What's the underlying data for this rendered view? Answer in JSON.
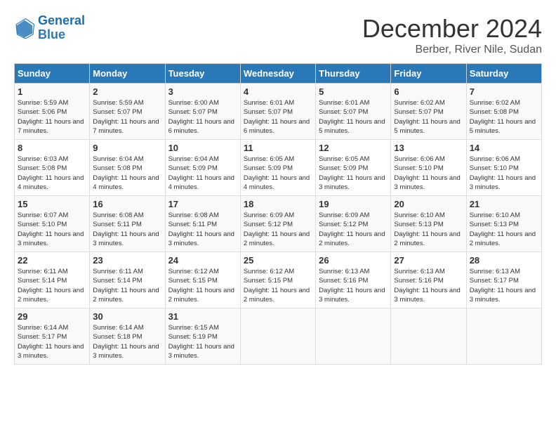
{
  "header": {
    "logo_general": "General",
    "logo_blue": "Blue",
    "month_title": "December 2024",
    "location": "Berber, River Nile, Sudan"
  },
  "days_of_week": [
    "Sunday",
    "Monday",
    "Tuesday",
    "Wednesday",
    "Thursday",
    "Friday",
    "Saturday"
  ],
  "weeks": [
    [
      {
        "day": "1",
        "sunrise": "5:59 AM",
        "sunset": "5:06 PM",
        "daylight": "11 hours and 7 minutes."
      },
      {
        "day": "2",
        "sunrise": "5:59 AM",
        "sunset": "5:07 PM",
        "daylight": "11 hours and 7 minutes."
      },
      {
        "day": "3",
        "sunrise": "6:00 AM",
        "sunset": "5:07 PM",
        "daylight": "11 hours and 6 minutes."
      },
      {
        "day": "4",
        "sunrise": "6:01 AM",
        "sunset": "5:07 PM",
        "daylight": "11 hours and 6 minutes."
      },
      {
        "day": "5",
        "sunrise": "6:01 AM",
        "sunset": "5:07 PM",
        "daylight": "11 hours and 5 minutes."
      },
      {
        "day": "6",
        "sunrise": "6:02 AM",
        "sunset": "5:07 PM",
        "daylight": "11 hours and 5 minutes."
      },
      {
        "day": "7",
        "sunrise": "6:02 AM",
        "sunset": "5:08 PM",
        "daylight": "11 hours and 5 minutes."
      }
    ],
    [
      {
        "day": "8",
        "sunrise": "6:03 AM",
        "sunset": "5:08 PM",
        "daylight": "11 hours and 4 minutes."
      },
      {
        "day": "9",
        "sunrise": "6:04 AM",
        "sunset": "5:08 PM",
        "daylight": "11 hours and 4 minutes."
      },
      {
        "day": "10",
        "sunrise": "6:04 AM",
        "sunset": "5:09 PM",
        "daylight": "11 hours and 4 minutes."
      },
      {
        "day": "11",
        "sunrise": "6:05 AM",
        "sunset": "5:09 PM",
        "daylight": "11 hours and 4 minutes."
      },
      {
        "day": "12",
        "sunrise": "6:05 AM",
        "sunset": "5:09 PM",
        "daylight": "11 hours and 3 minutes."
      },
      {
        "day": "13",
        "sunrise": "6:06 AM",
        "sunset": "5:10 PM",
        "daylight": "11 hours and 3 minutes."
      },
      {
        "day": "14",
        "sunrise": "6:06 AM",
        "sunset": "5:10 PM",
        "daylight": "11 hours and 3 minutes."
      }
    ],
    [
      {
        "day": "15",
        "sunrise": "6:07 AM",
        "sunset": "5:10 PM",
        "daylight": "11 hours and 3 minutes."
      },
      {
        "day": "16",
        "sunrise": "6:08 AM",
        "sunset": "5:11 PM",
        "daylight": "11 hours and 3 minutes."
      },
      {
        "day": "17",
        "sunrise": "6:08 AM",
        "sunset": "5:11 PM",
        "daylight": "11 hours and 3 minutes."
      },
      {
        "day": "18",
        "sunrise": "6:09 AM",
        "sunset": "5:12 PM",
        "daylight": "11 hours and 2 minutes."
      },
      {
        "day": "19",
        "sunrise": "6:09 AM",
        "sunset": "5:12 PM",
        "daylight": "11 hours and 2 minutes."
      },
      {
        "day": "20",
        "sunrise": "6:10 AM",
        "sunset": "5:13 PM",
        "daylight": "11 hours and 2 minutes."
      },
      {
        "day": "21",
        "sunrise": "6:10 AM",
        "sunset": "5:13 PM",
        "daylight": "11 hours and 2 minutes."
      }
    ],
    [
      {
        "day": "22",
        "sunrise": "6:11 AM",
        "sunset": "5:14 PM",
        "daylight": "11 hours and 2 minutes."
      },
      {
        "day": "23",
        "sunrise": "6:11 AM",
        "sunset": "5:14 PM",
        "daylight": "11 hours and 2 minutes."
      },
      {
        "day": "24",
        "sunrise": "6:12 AM",
        "sunset": "5:15 PM",
        "daylight": "11 hours and 2 minutes."
      },
      {
        "day": "25",
        "sunrise": "6:12 AM",
        "sunset": "5:15 PM",
        "daylight": "11 hours and 2 minutes."
      },
      {
        "day": "26",
        "sunrise": "6:13 AM",
        "sunset": "5:16 PM",
        "daylight": "11 hours and 3 minutes."
      },
      {
        "day": "27",
        "sunrise": "6:13 AM",
        "sunset": "5:16 PM",
        "daylight": "11 hours and 3 minutes."
      },
      {
        "day": "28",
        "sunrise": "6:13 AM",
        "sunset": "5:17 PM",
        "daylight": "11 hours and 3 minutes."
      }
    ],
    [
      {
        "day": "29",
        "sunrise": "6:14 AM",
        "sunset": "5:17 PM",
        "daylight": "11 hours and 3 minutes."
      },
      {
        "day": "30",
        "sunrise": "6:14 AM",
        "sunset": "5:18 PM",
        "daylight": "11 hours and 3 minutes."
      },
      {
        "day": "31",
        "sunrise": "6:15 AM",
        "sunset": "5:19 PM",
        "daylight": "11 hours and 3 minutes."
      },
      null,
      null,
      null,
      null
    ]
  ]
}
